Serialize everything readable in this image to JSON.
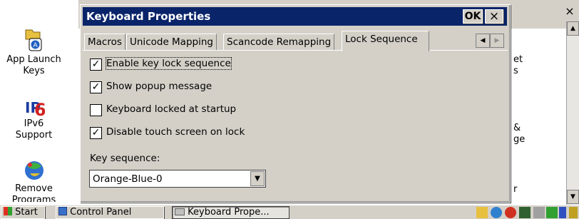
{
  "desktop": {
    "icons": [
      {
        "label_1": "App Launch",
        "label_2": "Keys",
        "icon": "app-launch-keys-icon"
      },
      {
        "label_1": "IPv6",
        "label_2": "Support",
        "icon": "ipv6-icon"
      },
      {
        "label_1": "Remove",
        "label_2": "Programs",
        "icon": "remove-programs-icon"
      }
    ],
    "partial_text": [
      "et",
      "s",
      "&",
      "ge",
      "r"
    ]
  },
  "control_panel": {
    "close_label": "×"
  },
  "dialog": {
    "title": "Keyboard Properties",
    "ok_label": "OK",
    "close_label": "×",
    "tabs": [
      "Macros",
      "Unicode Mapping",
      "Scancode Remapping",
      "Lock Sequence"
    ],
    "active_tab": "Lock Sequence",
    "options": [
      {
        "label": "Enable key lock sequence",
        "checked": true
      },
      {
        "label": "Show popup message",
        "checked": true
      },
      {
        "label": "Keyboard locked at startup",
        "checked": false
      },
      {
        "label": "Disable touch screen on lock",
        "checked": true
      }
    ],
    "key_sequence_label": "Key sequence:",
    "key_sequence_value": "Orange-Blue-0"
  },
  "taskbar": {
    "start_label": "Start",
    "items": [
      "Control Panel",
      "Keyboard Prope..."
    ]
  }
}
